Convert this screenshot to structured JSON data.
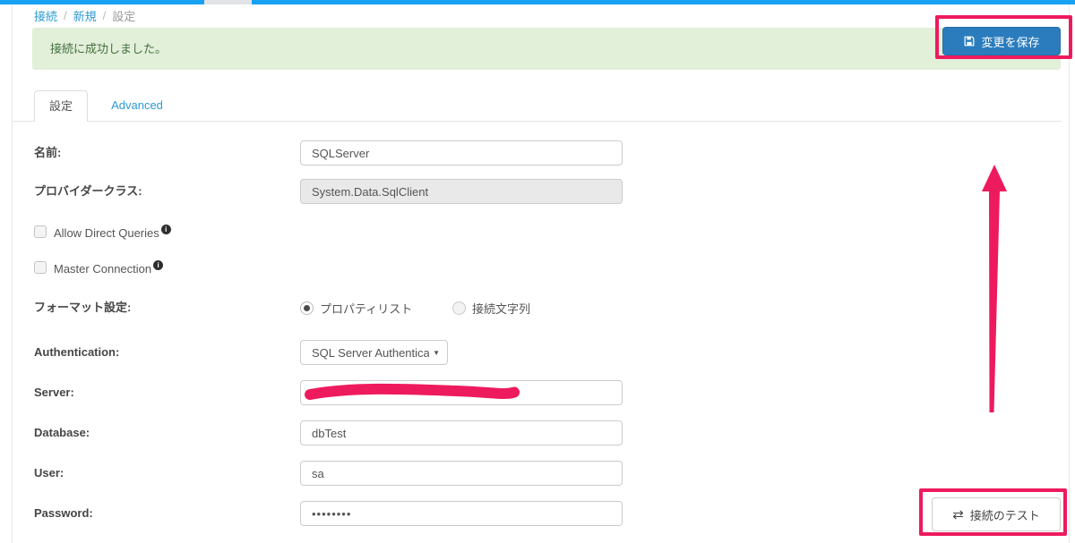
{
  "breadcrumb": {
    "separator": "/",
    "items": [
      {
        "label": "接続"
      },
      {
        "label": "新規"
      },
      {
        "label": "設定"
      }
    ]
  },
  "alert": {
    "message": "接続に成功しました。"
  },
  "actions": {
    "save_label": "変更を保存",
    "test_label": "接続のテスト"
  },
  "tabs": {
    "settings": "設定",
    "advanced": "Advanced"
  },
  "form": {
    "name": {
      "label": "名前:",
      "value": "SQLServer"
    },
    "provider_class": {
      "label": "プロバイダークラス:",
      "value": "System.Data.SqlClient"
    },
    "allow_direct_queries": {
      "label": "Allow Direct Queries",
      "checked": false
    },
    "master_connection": {
      "label": "Master Connection",
      "checked": false
    },
    "format": {
      "label": "フォーマット設定:",
      "options": [
        {
          "label": "プロパティリスト",
          "selected": true
        },
        {
          "label": "接続文字列",
          "selected": false
        }
      ]
    },
    "authentication": {
      "label": "Authentication:",
      "value": "SQL Server Authentica"
    },
    "server": {
      "label": "Server:",
      "value": ""
    },
    "database": {
      "label": "Database:",
      "value": "dbTest"
    },
    "user": {
      "label": "User:",
      "value": "sa"
    },
    "password": {
      "label": "Password:",
      "value": "••••••••"
    }
  },
  "icons": {
    "info_glyph": "i",
    "caret_glyph": "▼",
    "test_glyph": "⇄"
  },
  "colors": {
    "topbar_blue": "#18a2f3",
    "link_blue": "#2e9ad3",
    "save_button_blue": "#2b7cbd",
    "alert_bg": "#e2efd9",
    "alert_text": "#44703e",
    "annotation_pink": "#ee1a5e"
  }
}
